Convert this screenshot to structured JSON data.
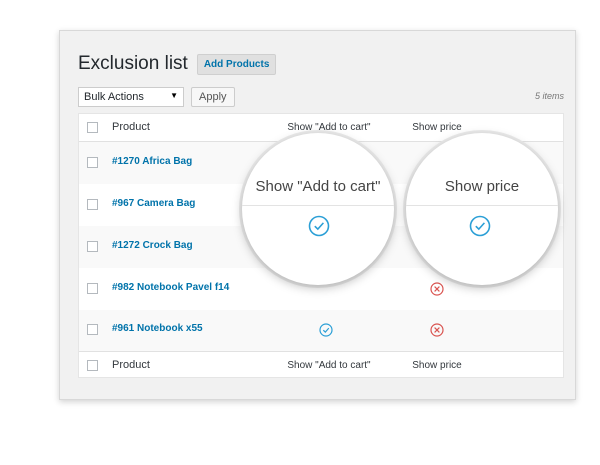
{
  "page": {
    "title": "Exclusion list",
    "add_button": "Add Products"
  },
  "toolbar": {
    "bulk_actions": "Bulk Actions",
    "apply": "Apply",
    "items_count": "5 items"
  },
  "table": {
    "columns": {
      "product": "Product",
      "show_add_to_cart": "Show \"Add to cart\"",
      "show_price": "Show price"
    },
    "rows": [
      {
        "product": "#1270 Africa Bag"
      },
      {
        "product": "#967 Camera Bag"
      },
      {
        "product": "#1272 Crock Bag"
      },
      {
        "product": "#982 Notebook Pavel f14",
        "show_price": "no"
      },
      {
        "product": "#961 Notebook x55",
        "show_add_to_cart": "yes",
        "show_price": "no"
      }
    ]
  },
  "magnifiers": {
    "left_title": "Show \"Add to cart\"",
    "right_title": "Show price"
  },
  "colors": {
    "link": "#0073aa",
    "check": "#2b9fd6",
    "cross": "#d9534f"
  }
}
